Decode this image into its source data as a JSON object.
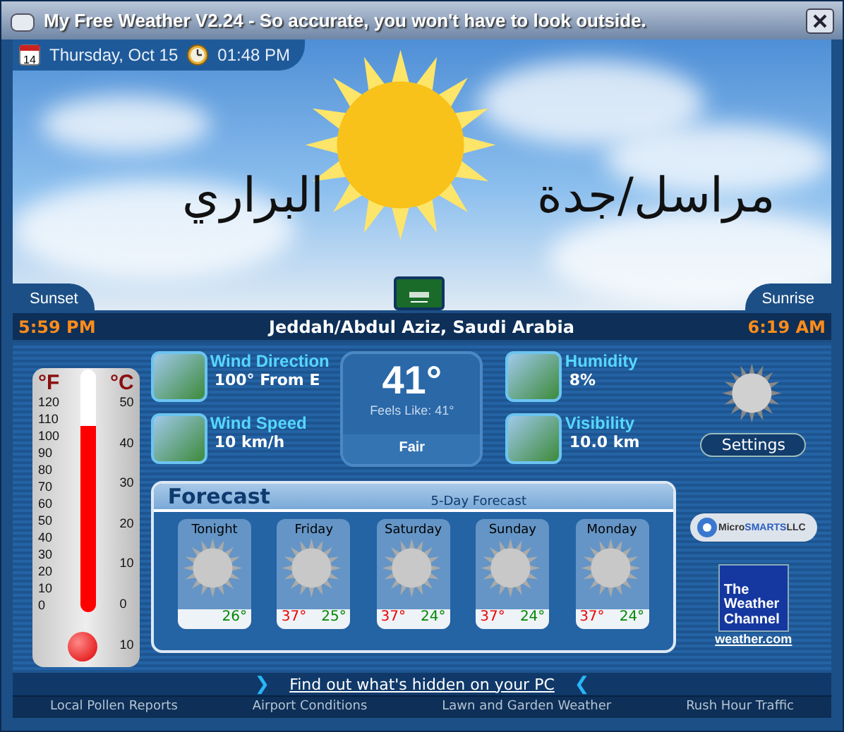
{
  "window": {
    "title": "My Free Weather V2.24 -  So accurate, you won't have to look outside."
  },
  "header": {
    "date": "Thursday, Oct 15",
    "time": "01:48 PM",
    "calendar_day": "14"
  },
  "sky_text": [
    "مراسل/جدة",
    "البراري"
  ],
  "sun": {
    "sunset_label": "Sunset",
    "sunrise_label": "Sunrise",
    "sunset_time": "5:59 PM",
    "sunrise_time": "6:19 AM"
  },
  "location": "Jeddah/Abdul Aziz, Saudi Arabia",
  "thermometer": {
    "f_label": "°F",
    "c_label": "°C",
    "f_ticks": [
      "120",
      "110",
      "100",
      "90",
      "80",
      "70",
      "60",
      "50",
      "40",
      "30",
      "20",
      "10",
      "0"
    ],
    "c_ticks": [
      "50",
      "40",
      "30",
      "20",
      "10",
      "0",
      "10"
    ],
    "level": 0.77
  },
  "conditions": [
    {
      "label": "Wind Direction",
      "value": "100° From E"
    },
    {
      "label": "Wind Speed",
      "value": "10 km/h"
    },
    {
      "label": "Humidity",
      "value": "8%"
    },
    {
      "label": "Visibility",
      "value": "10.0 km"
    }
  ],
  "current": {
    "temp": "41°",
    "feels_like": "Feels Like: 41°",
    "summary": "Fair"
  },
  "settings_label": "Settings",
  "forecast": {
    "title": "Forecast",
    "subtitle": "5-Day Forecast",
    "days": [
      {
        "day": "Tonight",
        "low": "26°"
      },
      {
        "day": "Friday",
        "high": "37°",
        "low": "25°"
      },
      {
        "day": "Saturday",
        "high": "37°",
        "low": "24°"
      },
      {
        "day": "Sunday",
        "high": "37°",
        "low": "24°"
      },
      {
        "day": "Monday",
        "high": "37°",
        "low": "24°"
      }
    ]
  },
  "sponsors": {
    "microsmarts": [
      "Micro",
      "SMARTS",
      "LLC"
    ],
    "twc": [
      "The",
      "Weather",
      "Channel"
    ],
    "twc_url": "weather.com"
  },
  "promo_link": "Find out what's hidden on your PC",
  "promo_chevrons": [
    "❯",
    "❮"
  ],
  "footer_links": [
    "Local Pollen Reports",
    "Airport Conditions",
    "Lawn and Garden Weather",
    "Rush Hour Traffic"
  ]
}
